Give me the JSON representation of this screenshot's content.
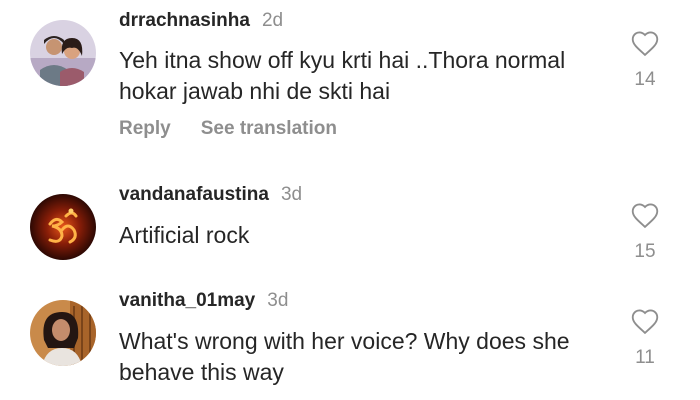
{
  "colors": {
    "text": "#262626",
    "secondary": "#8e8e8e",
    "background": "#ffffff"
  },
  "comments": [
    {
      "username": "drrachnasinha",
      "time": "2d",
      "text": "Yeh itna show off kyu krti hai ..Thora normal hokar jawab nhi de skti hai",
      "likes": "14",
      "avatar_icon": "couple-photo-avatar",
      "actions": {
        "reply": "Reply",
        "translate": "See translation"
      }
    },
    {
      "username": "vandanafaustina",
      "time": "3d",
      "text": "Artificial rock",
      "likes": "15",
      "avatar_icon": "om-symbol-avatar"
    },
    {
      "username": "vanitha_01may",
      "time": "3d",
      "text": "What's wrong with her voice? Why does she behave this way",
      "likes": "11",
      "avatar_icon": "woman-portrait-avatar"
    }
  ]
}
